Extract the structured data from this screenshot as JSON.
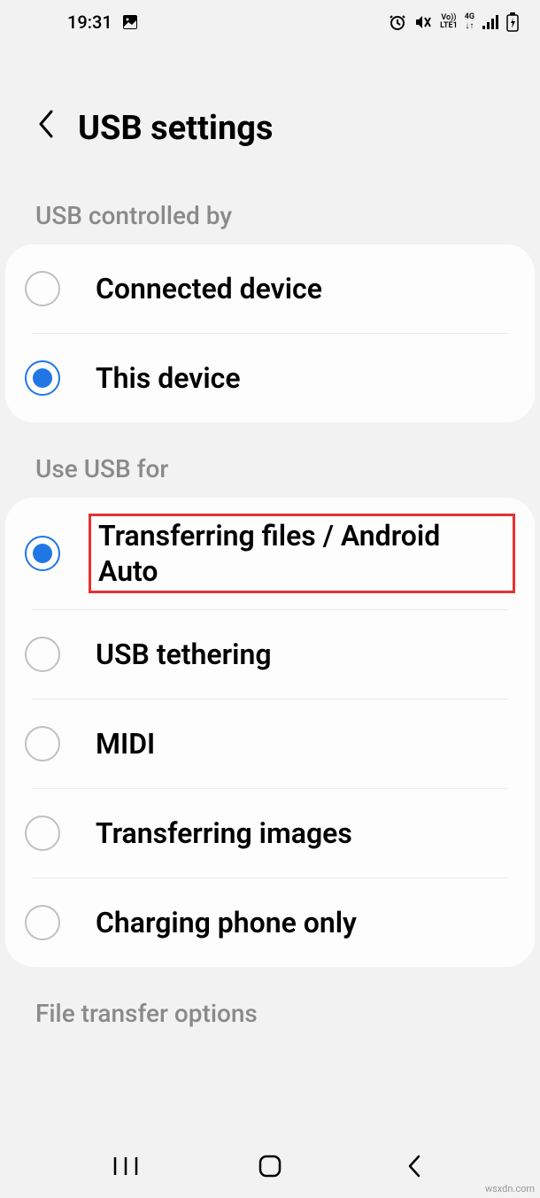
{
  "status": {
    "time": "19:31",
    "volte": "Vo))",
    "lte": "LTE1",
    "network": "4G"
  },
  "header": {
    "title": "USB settings"
  },
  "sections": {
    "controlled_by": {
      "label": "USB controlled by",
      "options": {
        "connected": "Connected device",
        "this_device": "This device"
      }
    },
    "use_for": {
      "label": "Use USB for",
      "options": {
        "transfer_files": "Transferring files / Android Auto",
        "tethering": "USB tethering",
        "midi": "MIDI",
        "images": "Transferring images",
        "charging": "Charging phone only"
      }
    },
    "file_transfer": {
      "label": "File transfer options"
    }
  },
  "watermark": "wsxdn.com"
}
